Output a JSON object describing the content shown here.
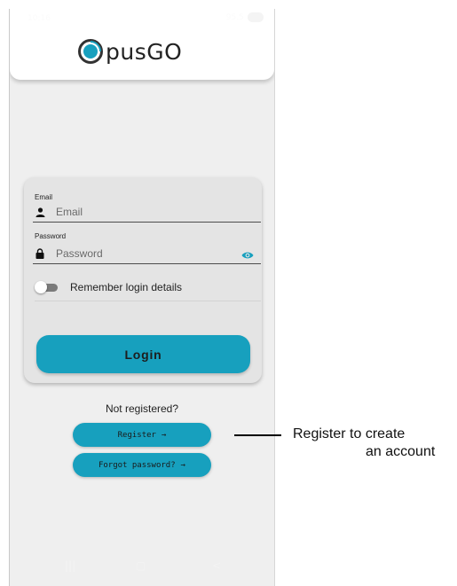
{
  "status_bar": {
    "time": "10:16",
    "right_text": "95.5",
    "battery": "85"
  },
  "app": {
    "logo_text_left": "pus",
    "logo_text_right": "GO",
    "logo_letter": "O"
  },
  "form": {
    "email": {
      "label": "Email",
      "placeholder": "Email",
      "value": ""
    },
    "password": {
      "label": "Password",
      "placeholder": "Password",
      "value": ""
    },
    "remember": {
      "label": "Remember login details",
      "checked": false
    },
    "login_label": "Login"
  },
  "footer": {
    "not_registered": "Not registered?",
    "register_label": "Register",
    "forgot_label": "Forgot password?",
    "arrow": "→"
  },
  "nav": {
    "recent": "|||",
    "home": "▢",
    "back": "<"
  },
  "annotation": {
    "line1": "Register to create",
    "line2": "an account"
  },
  "colors": {
    "accent": "#17a0be",
    "background": "#efefef",
    "card": "#e4e4e4"
  }
}
